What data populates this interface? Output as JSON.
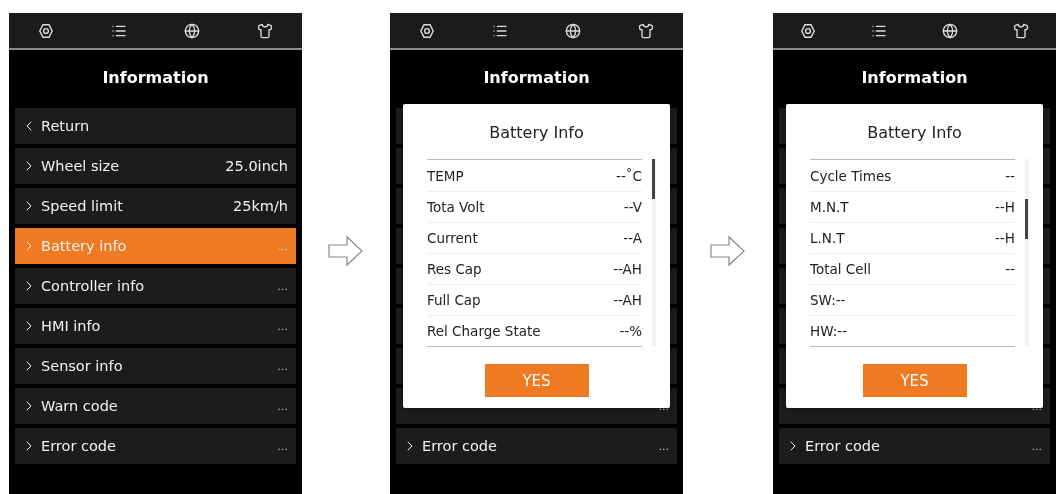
{
  "screens": [
    {
      "toolbar": {
        "icons": [
          {
            "kind": "settings"
          },
          {
            "kind": "list"
          },
          {
            "kind": "globe"
          },
          {
            "kind": "shirt"
          }
        ]
      },
      "title": "Information",
      "menu": [
        {
          "kind": "back",
          "label": "Return",
          "selected": false
        },
        {
          "kind": "submenu",
          "label": "Wheel size",
          "value": "25.0inch",
          "selected": false
        },
        {
          "kind": "submenu",
          "label": "Speed limit",
          "value": "25km/h",
          "selected": false
        },
        {
          "kind": "submenu",
          "label": "Battery info",
          "value": "...",
          "selected": true
        },
        {
          "kind": "submenu",
          "label": "Controller info",
          "value": "...",
          "selected": false
        },
        {
          "kind": "submenu",
          "label": "HMI info",
          "value": "...",
          "selected": false
        },
        {
          "kind": "submenu",
          "label": "Sensor info",
          "value": "...",
          "selected": false
        },
        {
          "kind": "submenu",
          "label": "Warn code",
          "value": "...",
          "selected": false
        },
        {
          "kind": "submenu",
          "label": "Error code",
          "value": "...",
          "selected": false
        }
      ]
    },
    {
      "toolbar": {
        "icons": [
          {
            "kind": "settings"
          },
          {
            "kind": "list"
          },
          {
            "kind": "globe"
          },
          {
            "kind": "shirt"
          }
        ]
      },
      "title": "Information",
      "menu": [
        {
          "kind": "covered"
        },
        {
          "kind": "covered"
        },
        {
          "kind": "covered"
        },
        {
          "kind": "covered"
        },
        {
          "kind": "covered"
        },
        {
          "kind": "covered"
        },
        {
          "kind": "covered"
        },
        {
          "kind": "covered",
          "value": "..."
        },
        {
          "kind": "submenu",
          "label": "Error code",
          "value": "...",
          "selected": false
        }
      ],
      "dialog": {
        "title": "Battery Info",
        "scrolled": false,
        "rows": [
          {
            "label": "TEMP",
            "value": "--˚C"
          },
          {
            "label": "Tota Volt",
            "value": "--V"
          },
          {
            "label": "Current",
            "value": "--A"
          },
          {
            "label": "Res Cap",
            "value": "--AH"
          },
          {
            "label": "Full Cap",
            "value": "--AH"
          },
          {
            "label": "Rel Charge State",
            "value": "--%"
          }
        ],
        "button": "YES"
      }
    },
    {
      "toolbar": {
        "icons": [
          {
            "kind": "settings"
          },
          {
            "kind": "list"
          },
          {
            "kind": "globe"
          },
          {
            "kind": "shirt"
          }
        ]
      },
      "title": "Information",
      "menu": [
        {
          "kind": "covered"
        },
        {
          "kind": "covered"
        },
        {
          "kind": "covered"
        },
        {
          "kind": "covered"
        },
        {
          "kind": "covered"
        },
        {
          "kind": "covered"
        },
        {
          "kind": "covered"
        },
        {
          "kind": "covered",
          "value": "..."
        },
        {
          "kind": "submenu",
          "label": "Error code",
          "value": "...",
          "selected": false
        }
      ],
      "dialog": {
        "title": "Battery Info",
        "scrolled": true,
        "rows": [
          {
            "label": "Cycle Times",
            "value": "--"
          },
          {
            "label": "M.N.T",
            "value": "--H"
          },
          {
            "label": "L.N.T",
            "value": "--H"
          },
          {
            "label": "Total Cell",
            "value": "--"
          },
          {
            "label": "SW:--"
          },
          {
            "label": "HW:--"
          }
        ],
        "button": "YES"
      }
    }
  ]
}
